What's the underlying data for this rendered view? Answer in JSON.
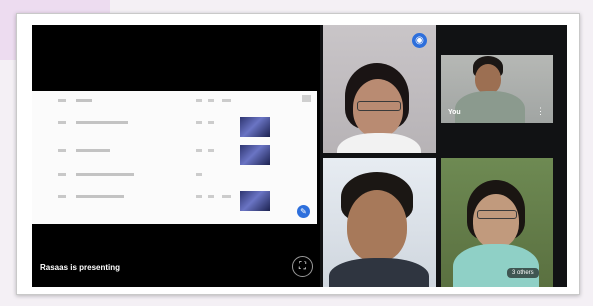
{
  "presentation": {
    "presenting_label": "Rasaas is presenting",
    "fullscreen_icon": "fullscreen-icon",
    "edit_icon": "edit-icon"
  },
  "tiles": {
    "pin_icon": "pin-icon",
    "self_label": "You",
    "self_more_icon": "more-icon",
    "others_label": "3 others"
  },
  "colors": {
    "meeting_bg": "#111214",
    "accent": "#2d6fdc"
  }
}
